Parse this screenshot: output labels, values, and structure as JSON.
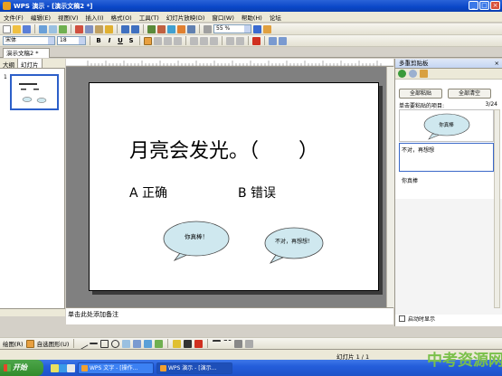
{
  "window": {
    "title": "WPS 演示 - [演示文稿2 *]"
  },
  "menu": [
    "文件(F)",
    "编辑(E)",
    "视图(V)",
    "插入(I)",
    "格式(O)",
    "工具(T)",
    "幻灯片放映(D)",
    "窗口(W)",
    "帮助(H)",
    "论坛"
  ],
  "toolbar": {
    "zoom": "55 %",
    "font": "宋体",
    "size": "18",
    "bold": "B",
    "italic": "I",
    "underline": "U",
    "strike": "S"
  },
  "doc_tab": "演示文稿2 *",
  "left_panel": {
    "tabs": [
      "大纲",
      "幻灯片"
    ],
    "slide_number": "1"
  },
  "slide": {
    "question": "月亮会发光。（　　）",
    "option_a": "A 正确",
    "option_b": "B 错误",
    "bubble_left": "你真棒！",
    "bubble_right": "不对，再想想！"
  },
  "notes_placeholder": "单击此处添加备注",
  "task_pane": {
    "title": "多重剪贴板",
    "paste_all": "全部粘贴",
    "clear_all": "全部清空",
    "hint": "单击要粘贴的项目:",
    "counter": "3/24",
    "items": [
      "你真棒",
      "不对，再想想",
      "你真棒"
    ],
    "show_on_start": "启动时显示"
  },
  "draw_toolbar": {
    "draw": "绘图(R)",
    "autoshapes": "自选图形(U)"
  },
  "status": {
    "slide": "幻灯片 1 / 1"
  },
  "taskbar": {
    "start": "开始",
    "tasks": [
      "WPS 文字 - [操作...",
      "WPS 演示 - [演示..."
    ]
  },
  "watermark": "中考资源网",
  "colors": {
    "bubble_fill": "#cfe8ef",
    "title_blue": "#0a47c8",
    "taskbar": "#245edb"
  }
}
